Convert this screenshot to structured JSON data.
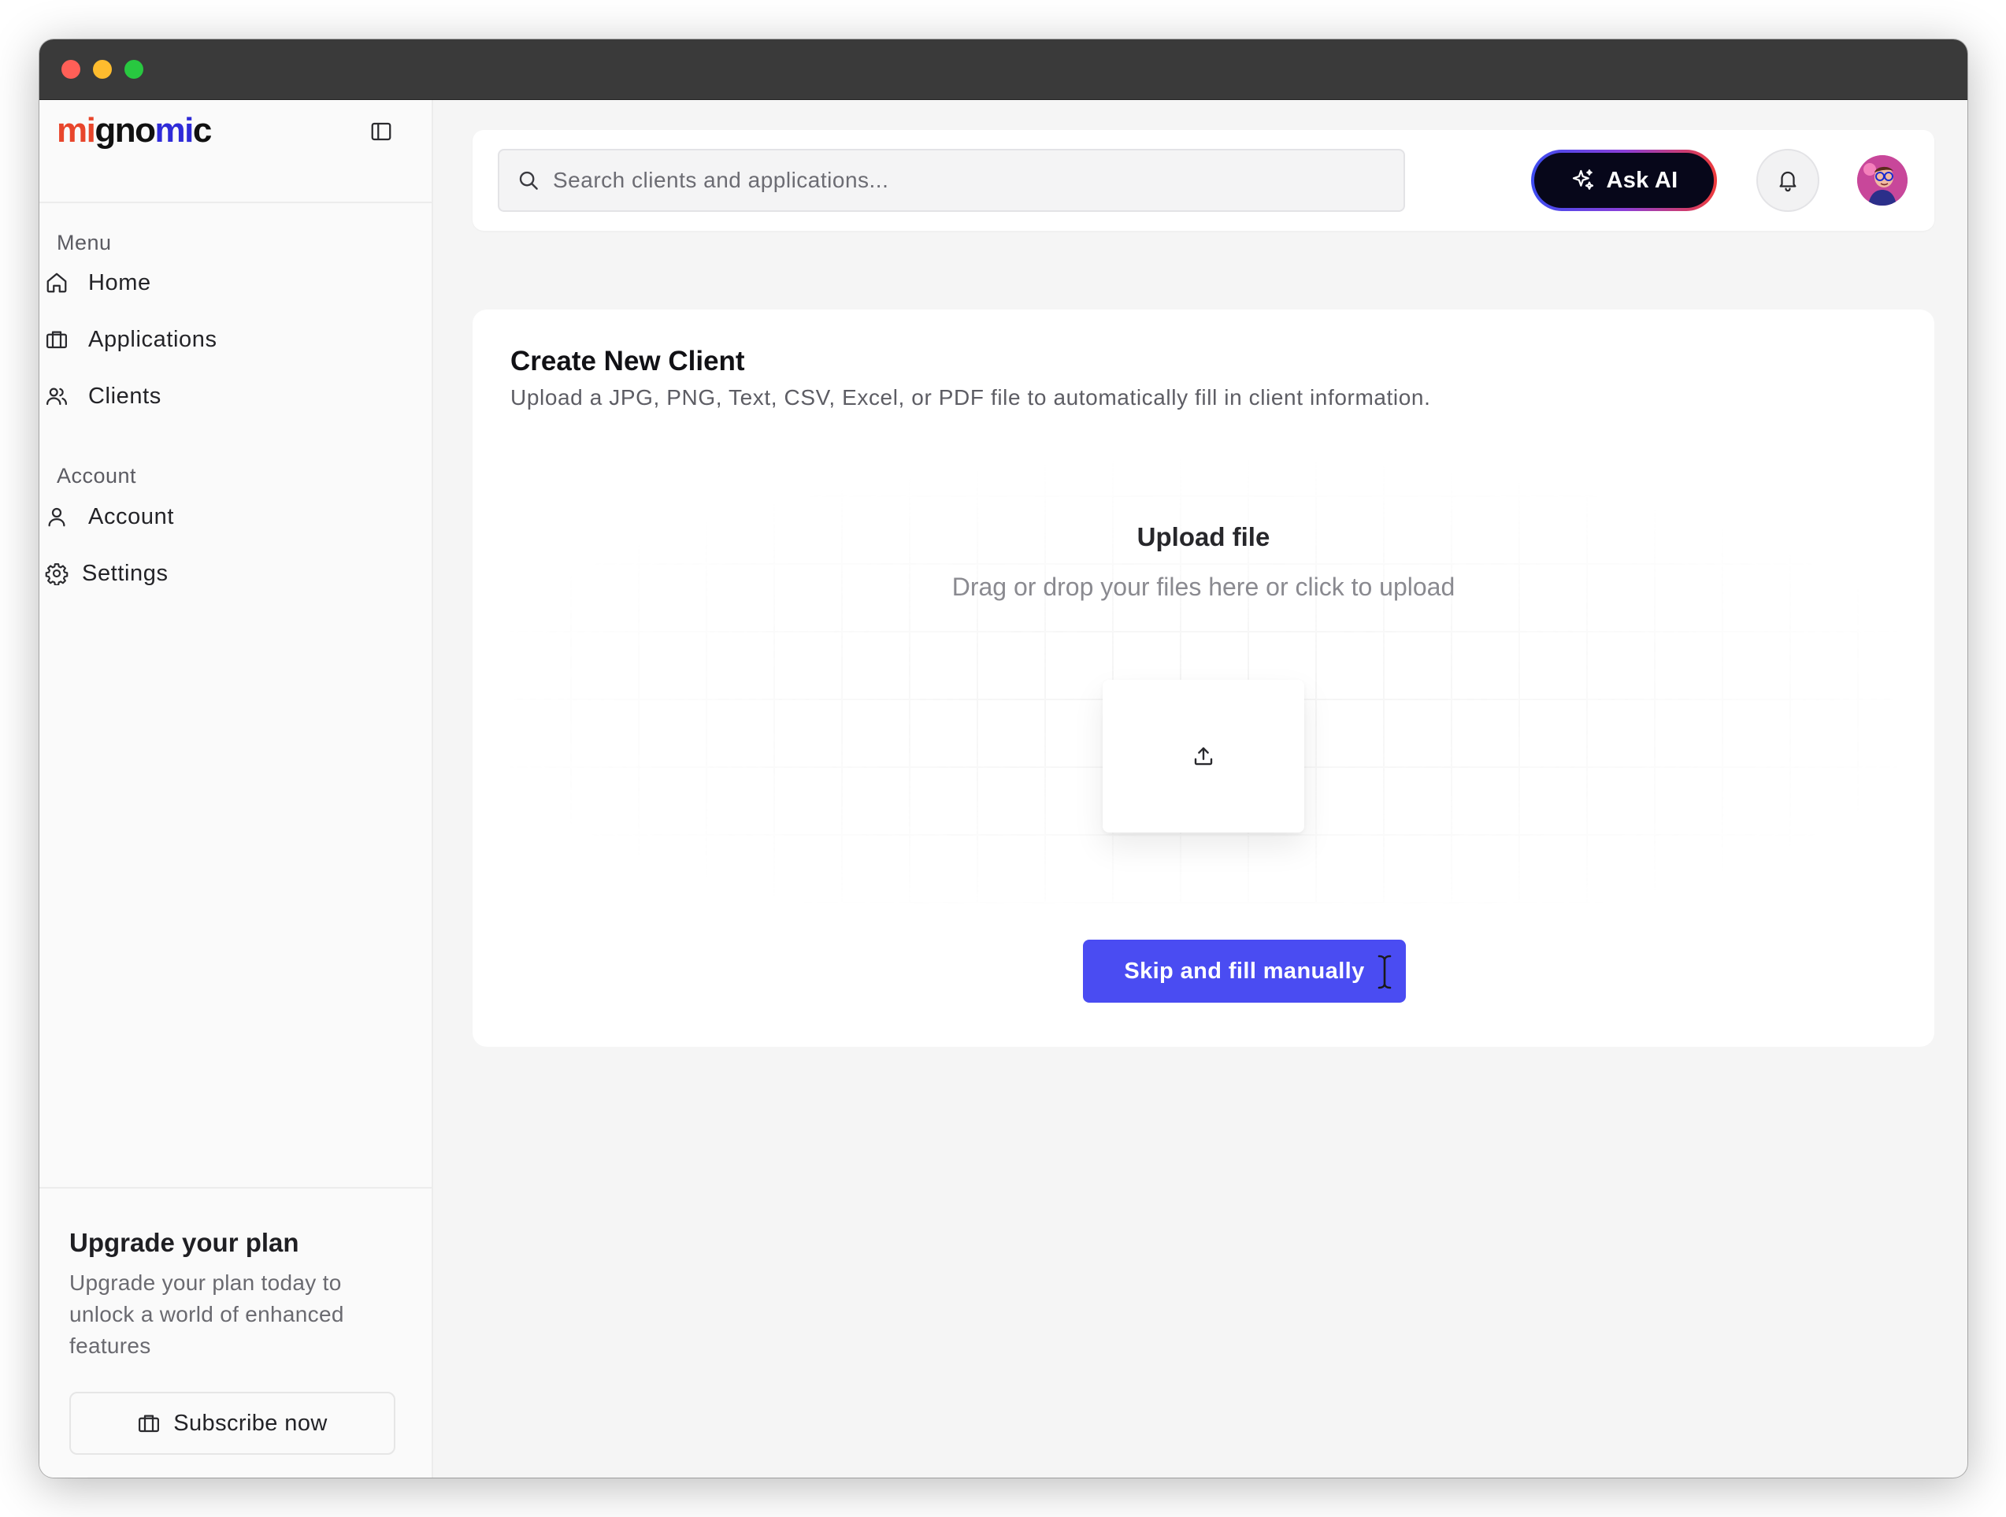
{
  "app": {
    "logo": {
      "part1": "mi",
      "part2": "gno",
      "part3": "mi",
      "part4": "c"
    }
  },
  "sidebar": {
    "menu_label": "Menu",
    "menu_items": [
      {
        "label": "Home",
        "icon": "home-icon"
      },
      {
        "label": "Applications",
        "icon": "briefcase-icon"
      },
      {
        "label": "Clients",
        "icon": "users-icon"
      }
    ],
    "account_label": "Account",
    "account_items": [
      {
        "label": "Account",
        "icon": "user-icon"
      },
      {
        "label": "Settings",
        "icon": "gear-icon"
      }
    ],
    "upgrade": {
      "title": "Upgrade your plan",
      "text": "Upgrade your plan today to unlock a world of enhanced features",
      "button_label": "Subscribe now"
    }
  },
  "header": {
    "search_placeholder": "Search clients and applications...",
    "search_value": "",
    "ask_ai_label": "Ask AI"
  },
  "card": {
    "title": "Create New Client",
    "subtitle": "Upload a JPG, PNG, Text, CSV, Excel, or PDF file to automatically fill in client information.",
    "upload_title": "Upload file",
    "upload_subtitle": "Drag or drop your files here or click to upload",
    "skip_button_label": "Skip and fill manually"
  },
  "colors": {
    "primary_button": "#4a4cf2",
    "ask_ai_bg": "#07071a",
    "logo_red": "#e8462c",
    "logo_blue": "#2f2bd8"
  }
}
